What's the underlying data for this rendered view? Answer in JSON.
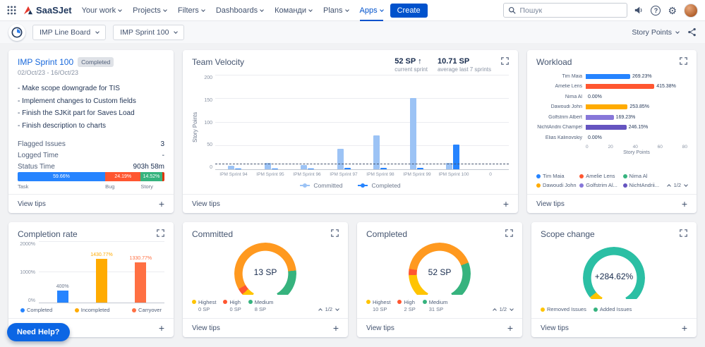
{
  "navbar": {
    "logo_text": "SaaSJet",
    "items": [
      "Your work",
      "Projects",
      "Filters",
      "Dashboards",
      "Команди",
      "Plans",
      "Apps"
    ],
    "create_label": "Create",
    "search_placeholder": "Пошук"
  },
  "toolbar": {
    "board_select": "IMP Line Board",
    "sprint_select": "IMP Sprint 100",
    "unit_select": "Story Points"
  },
  "view_tips_label": "View tips",
  "need_help_label": "Need Help?",
  "cards": {
    "sprint_summary": {
      "title": "IMP Sprint 100",
      "badge": "Completed",
      "date_range": "02/Oct/23 - 16/Oct/23",
      "notes": [
        "- Make scope downgrade for TIS",
        "- Implement changes to Custom fields",
        "- Finish the SJKit part for Saves Load",
        "- Finish description to charts"
      ],
      "stats": [
        {
          "label": "Flagged Issues",
          "value": "3"
        },
        {
          "label": "Logged Time",
          "value": "-"
        },
        {
          "label": "Status Time",
          "value": "903h 58m"
        }
      ]
    },
    "team_velocity": {
      "title": "Team Velocity",
      "current": {
        "value": "52 SP",
        "arrow": "↑",
        "caption": "current sprint"
      },
      "average": {
        "value": "10.71 SP",
        "caption": "average last 7 sprints"
      }
    },
    "workload": {
      "title": "Workload",
      "pagination": "1/2"
    },
    "completion_rate": {
      "title": "Completion rate"
    },
    "committed": {
      "title": "Committed",
      "pagination": "1/2",
      "legend": [
        {
          "label": "Highest",
          "value": "0 SP",
          "color": "#FFC400"
        },
        {
          "label": "High",
          "value": "0 SP",
          "color": "#FF5630"
        },
        {
          "label": "Medium",
          "value": "8 SP",
          "color": "#36B37E"
        }
      ]
    },
    "completed": {
      "title": "Completed",
      "pagination": "1/2",
      "legend": [
        {
          "label": "Highest",
          "value": "10 SP",
          "color": "#FFC400"
        },
        {
          "label": "High",
          "value": "2 SP",
          "color": "#FF5630"
        },
        {
          "label": "Medium",
          "value": "31 SP",
          "color": "#36B37E"
        }
      ]
    },
    "scope_change": {
      "title": "Scope change",
      "legend": [
        {
          "label": "Removed Issues",
          "color": "#FFC400"
        },
        {
          "label": "Added Issues",
          "color": "#36B37E"
        }
      ]
    }
  },
  "chart_data": [
    {
      "id": "issue_distribution",
      "type": "bar",
      "stacked": true,
      "segments": [
        {
          "label": "Task",
          "pct": 59.66,
          "color": "#2684FF"
        },
        {
          "label": "Bug",
          "pct": 24.19,
          "color": "#FF5630"
        },
        {
          "label": "Story",
          "pct": 14.52,
          "color": "#36B37E"
        },
        {
          "label": "",
          "pct": 1.63,
          "color": "#DE350B"
        }
      ]
    },
    {
      "id": "team_velocity",
      "type": "bar",
      "title": "Team Velocity",
      "categories": [
        "IPM Sprint 94",
        "IPM Sprint 95",
        "IPM Sprint 96",
        "IPM Sprint 97",
        "IPM Sprint 98",
        "IPM Sprint 99",
        "IPM Sprint 100",
        "0"
      ],
      "series": [
        {
          "name": "Committed",
          "color": "#9CC3F5",
          "values": [
            8,
            13,
            9,
            44,
            72,
            152,
            13,
            0
          ]
        },
        {
          "name": "Completed",
          "color": "#2684FF",
          "values": [
            1,
            2,
            1,
            3,
            3,
            3,
            52,
            0
          ]
        }
      ],
      "ylabel": "Story Points",
      "ylim": [
        0,
        200
      ],
      "yticks": [
        200,
        150,
        100,
        50,
        0
      ],
      "average_line": 10.71,
      "legend_position": "bottom"
    },
    {
      "id": "workload",
      "type": "bar",
      "horizontal": true,
      "title": "Workload",
      "categories": [
        "Tim Maia",
        "Amelie Lens",
        "Nima Al",
        "Dawoudi John",
        "Golfstrim Albert",
        "NichtAndrii Champel",
        "Elias Kalinovskiy"
      ],
      "values": [
        35,
        54,
        0,
        33,
        22,
        32,
        0
      ],
      "value_labels": [
        "269.23%",
        "415.38%",
        "0.00%",
        "253.85%",
        "169.23%",
        "246.15%",
        "0.00%"
      ],
      "colors": [
        "#2684FF",
        "#FF5630",
        "#36B37E",
        "#FFAB00",
        "#8777D9",
        "#6554C0",
        "#00B8D9"
      ],
      "xlabel": "Story Points",
      "xlim": [
        0,
        80
      ],
      "xticks": [
        0,
        20,
        40,
        60,
        80
      ],
      "legend": [
        {
          "label": "Tim Maia",
          "color": "#2684FF"
        },
        {
          "label": "Amelie Lens",
          "color": "#FF5630"
        },
        {
          "label": "Nima Al",
          "color": "#36B37E"
        },
        {
          "label": "Dawoudi John",
          "color": "#FFAB00"
        },
        {
          "label": "Golfstrim Al...",
          "color": "#8777D9"
        },
        {
          "label": "NichtAndrii...",
          "color": "#6554C0"
        }
      ]
    },
    {
      "id": "completion_rate",
      "type": "bar",
      "title": "Completion rate",
      "categories": [
        "Completed",
        "Incompleted",
        "Carryover"
      ],
      "values": [
        400,
        1430.77,
        1330.77
      ],
      "value_labels": [
        "400%",
        "1430.77%",
        "1330.77%"
      ],
      "label_colors": [
        "#6B778C",
        "#FFAB00",
        "#FF7043"
      ],
      "colors": [
        "#2684FF",
        "#FFAB00",
        "#FF7043"
      ],
      "ylim": [
        0,
        2000
      ],
      "yticks": [
        "2000%",
        "1000%",
        "0%"
      ],
      "legend": [
        {
          "label": "Completed",
          "color": "#2684FF"
        },
        {
          "label": "Incompleted",
          "color": "#FFAB00"
        },
        {
          "label": "Carryover",
          "color": "#FF7043"
        }
      ]
    },
    {
      "id": "committed_gauge",
      "type": "gauge",
      "value_label": "13 SP",
      "segments": [
        {
          "color": "#FFC400",
          "frac": 0.06
        },
        {
          "color": "#FF5630",
          "frac": 0.04
        },
        {
          "color": "#FF991F",
          "frac": 0.68
        },
        {
          "color": "#36B37E",
          "frac": 0.22
        }
      ]
    },
    {
      "id": "completed_gauge",
      "type": "gauge",
      "value_label": "52 SP",
      "segments": [
        {
          "color": "#FFC400",
          "frac": 0.19
        },
        {
          "color": "#FF5630",
          "frac": 0.04
        },
        {
          "color": "#FF991F",
          "frac": 0.5
        },
        {
          "color": "#36B37E",
          "frac": 0.27
        }
      ]
    },
    {
      "id": "scope_change_gauge",
      "type": "gauge",
      "value_label": "+284.62%",
      "segments": [
        {
          "color": "#FFC400",
          "frac": 0.07
        },
        {
          "color": "#2BBFA4",
          "frac": 0.93
        }
      ]
    }
  ]
}
